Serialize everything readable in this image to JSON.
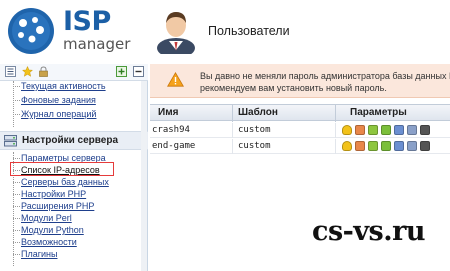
{
  "app": {
    "brand_isp": "ISP",
    "brand_manager": "manager",
    "page_title": "Пользователи"
  },
  "sidebar": {
    "top_items": [
      {
        "label": "Текущая активность",
        "icon": "activity"
      },
      {
        "label": "Фоновые задания",
        "icon": "jobs"
      },
      {
        "label": "Журнал операций",
        "icon": "log"
      }
    ],
    "section_label": "Настройки сервера",
    "section_icon": "server-settings-icon",
    "items": [
      {
        "label": "Параметры сервера",
        "selected": false
      },
      {
        "label": "Список IP-адресов",
        "selected": true
      },
      {
        "label": "Серверы баз данных",
        "selected": false
      },
      {
        "label": "Настройки PHP",
        "selected": false
      },
      {
        "label": "Расширения PHP",
        "selected": false
      },
      {
        "label": "Модули Perl",
        "selected": false
      },
      {
        "label": "Модули Python",
        "selected": false
      },
      {
        "label": "Возможности",
        "selected": false
      },
      {
        "label": "Плагины",
        "selected": false
      }
    ],
    "toolbar_icons": [
      "list-icon",
      "favorite-star-icon",
      "lock-icon",
      "expand-all-icon",
      "collapse-all-icon"
    ]
  },
  "warning": {
    "line1": "Вы давно не меняли пароль администратора базы данных Му",
    "line2": "рекомендуем вам установить новый пароль."
  },
  "table": {
    "columns": [
      "Имя",
      "Шаблон",
      "Параметры"
    ],
    "rows": [
      {
        "name": "crash94",
        "template": "custom"
      },
      {
        "name": "end-game",
        "template": "custom"
      }
    ],
    "param_icons": [
      {
        "name": "lamp-icon",
        "color": "#f2c21a"
      },
      {
        "name": "cgi-icon",
        "color": "#e8874a"
      },
      {
        "name": "php-icon",
        "color": "#8ec63f"
      },
      {
        "name": "ssi-icon",
        "color": "#7bbf3a"
      },
      {
        "name": "ssl-icon",
        "color": "#6b8fd1"
      },
      {
        "name": "mail-icon",
        "color": "#8aa0c8"
      },
      {
        "name": "shell-icon",
        "color": "#555555"
      }
    ]
  },
  "watermark": "cs-vs.ru",
  "colors": {
    "brand_blue": "#1b5fa6",
    "link_blue": "#1e3f8c",
    "warning_bg": "#fbe7dc",
    "selection_border": "#e53b3b"
  }
}
